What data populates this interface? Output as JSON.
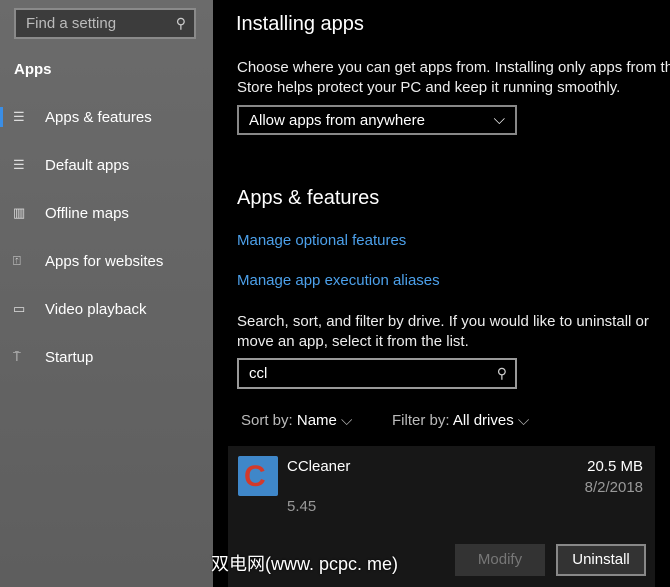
{
  "sidebar": {
    "search_placeholder": "Find a setting",
    "heading": "Apps",
    "items": [
      {
        "label": "Apps & features",
        "icon": "list-icon"
      },
      {
        "label": "Default apps",
        "icon": "default-list-icon"
      },
      {
        "label": "Offline maps",
        "icon": "map-icon"
      },
      {
        "label": "Apps for websites",
        "icon": "upload-box-icon"
      },
      {
        "label": "Video playback",
        "icon": "video-icon"
      },
      {
        "label": "Startup",
        "icon": "startup-icon"
      }
    ]
  },
  "main": {
    "installing_title": "Installing apps",
    "installing_desc1": "Choose where you can get apps from. Installing only apps from the",
    "installing_desc2": "Store helps protect your PC and keep it running smoothly.",
    "source_select": "Allow apps from anywhere",
    "features_title": "Apps & features",
    "link_optional": "Manage optional features",
    "link_aliases": "Manage app execution aliases",
    "search_desc1": "Search, sort, and filter by drive. If you would like to uninstall or",
    "search_desc2": "move an app, select it from the list.",
    "search_value": "ccl",
    "sort_label": "Sort by:",
    "sort_value": "Name",
    "filter_label": "Filter by:",
    "filter_value": "All drives",
    "app": {
      "name": "CCleaner",
      "version": "5.45",
      "size": "20.5 MB",
      "date": "8/2/2018",
      "modify": "Modify",
      "uninstall": "Uninstall"
    }
  },
  "watermark": "双电网(www. pcpc. me)"
}
